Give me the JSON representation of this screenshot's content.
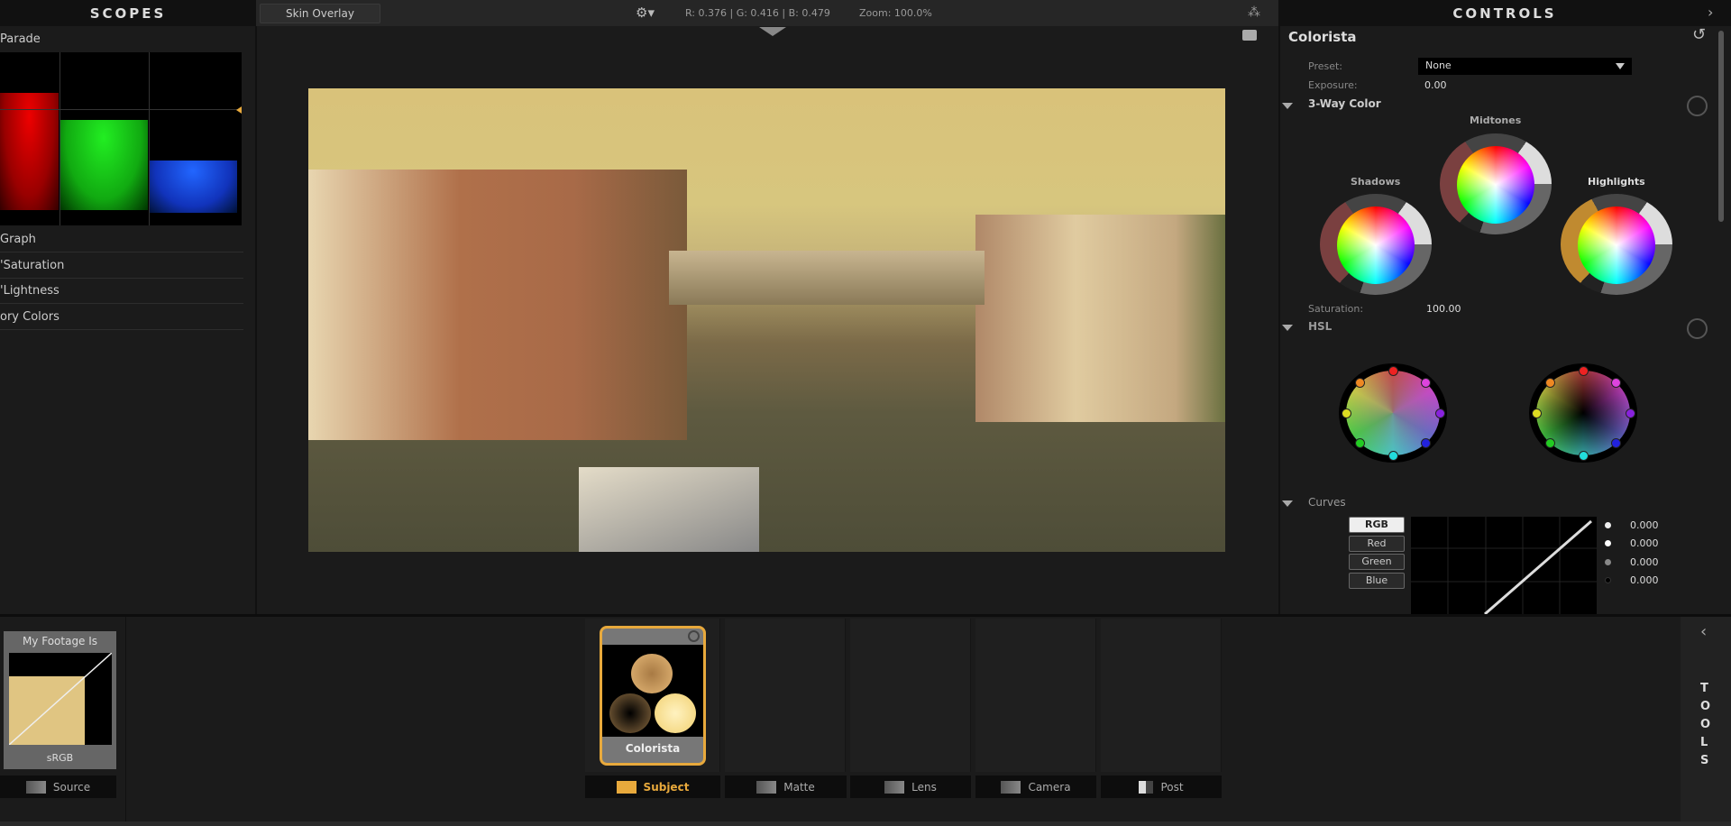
{
  "scopes": {
    "title": "SCOPES",
    "active": "Parade",
    "items": [
      "Graph",
      "'Saturation",
      "'Lightness",
      "ory Colors"
    ]
  },
  "toolbar": {
    "skin_overlay": "Skin Overlay",
    "readout": "R: 0.376 | G: 0.416 | B: 0.479",
    "zoom": "Zoom: 100.0%",
    "icons": [
      "gear-icon",
      "camera-icon",
      "nodes-icon"
    ]
  },
  "controls": {
    "title": "CONTROLS",
    "plugin": "Colorista",
    "preset_label": "Preset:",
    "preset_value": "None",
    "exposure_label": "Exposure:",
    "exposure_value": "0.00",
    "three_way": "3-Way Color",
    "midtones": "Midtones",
    "shadows": "Shadows",
    "highlights": "Highlights",
    "saturation_label": "Saturation:",
    "saturation_value": "100.00",
    "hsl": "HSL",
    "curves": "Curves",
    "curve_channels": [
      "RGB",
      "Red",
      "Green",
      "Blue"
    ],
    "active_channel": "RGB",
    "curve_values": [
      "0.000",
      "0.000",
      "0.000",
      "0.000"
    ]
  },
  "bottom": {
    "footage_title": "My Footage Is",
    "footage_profile": "sRGB",
    "source": "Source",
    "effect_card": "Colorista",
    "tabs": [
      "Subject",
      "Matte",
      "Lens",
      "Camera",
      "Post"
    ],
    "active_tab": "Subject",
    "tools": "TOOLS"
  },
  "colors": {
    "accent": "#e8a93c",
    "bg": "#1b1b1b"
  }
}
